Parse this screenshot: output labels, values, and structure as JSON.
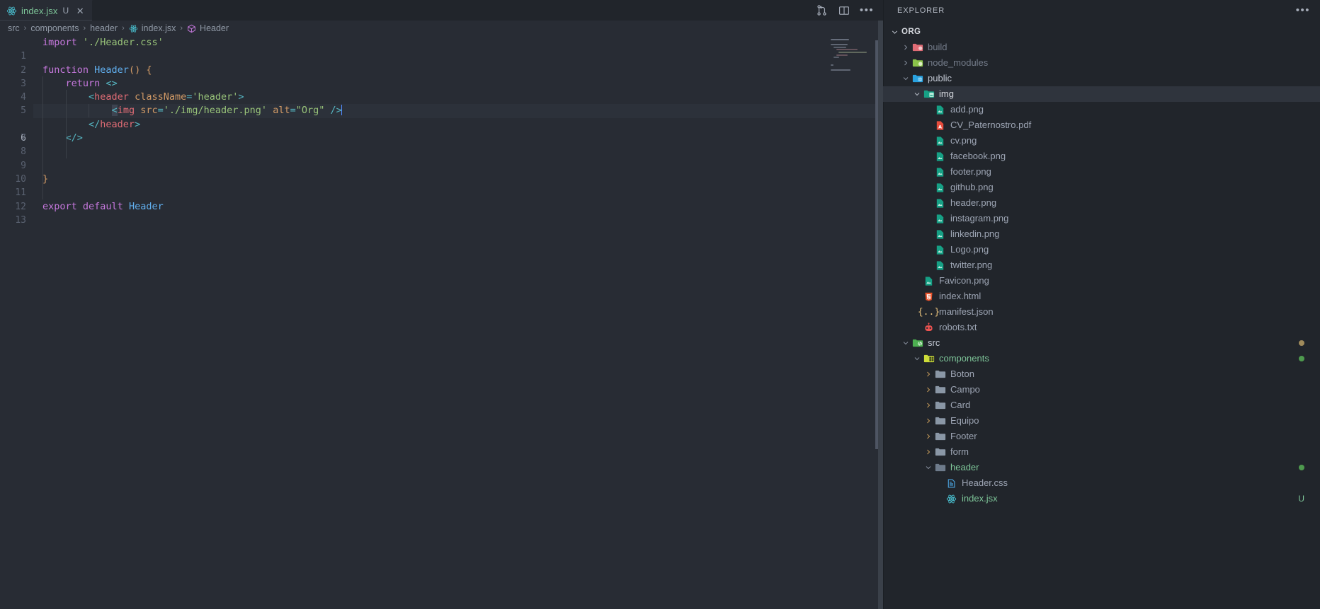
{
  "editor": {
    "tab": {
      "icon": "react-icon",
      "label": "index.jsx",
      "dirty_badge": "U",
      "close_label": "✕"
    },
    "actions": [
      {
        "name": "split-source-control-icon",
        "label": ""
      },
      {
        "name": "split-editor-icon",
        "label": ""
      },
      {
        "name": "more-actions-icon",
        "label": "•••"
      }
    ],
    "breadcrumb": [
      {
        "label": "src",
        "icon": ""
      },
      {
        "label": "components",
        "icon": ""
      },
      {
        "label": "header",
        "icon": ""
      },
      {
        "label": "index.jsx",
        "icon": "react-icon"
      },
      {
        "label": "Header",
        "icon": "cube-icon"
      }
    ],
    "breadcrumb_separator": "›",
    "active_line": 6,
    "cursor_column": 46,
    "lines": [
      {
        "n": "1",
        "text": "import './Header.css'"
      },
      {
        "n": "2",
        "text": ""
      },
      {
        "n": "3",
        "text": "function Header() {"
      },
      {
        "n": "4",
        "text": "    return <>"
      },
      {
        "n": "5",
        "text": "        <header className='header'>"
      },
      {
        "n": "6",
        "text": "            <img src='./img/header.png' alt=\"Org\" />"
      },
      {
        "n": "7",
        "text": "        </header>"
      },
      {
        "n": "8",
        "text": "    </>"
      },
      {
        "n": "9",
        "text": ""
      },
      {
        "n": "10",
        "text": ""
      },
      {
        "n": "11",
        "text": "}"
      },
      {
        "n": "12",
        "text": ""
      },
      {
        "n": "13",
        "text": "export default Header"
      }
    ],
    "colors": {
      "background": "#282c34",
      "active_line": "#2c313a",
      "keyword": "#c678dd",
      "string": "#98c379",
      "function": "#61afef",
      "tag": "#e06c75",
      "attribute": "#d19a66",
      "operator": "#56b6c2",
      "text": "#abb2bf",
      "line_number": "#5a6271",
      "cursor": "#528bff"
    }
  },
  "sidebar": {
    "title": "EXPLORER",
    "more_label": "•••",
    "root": {
      "label": "ORG",
      "expanded": true
    },
    "tree": [
      {
        "label": "build",
        "type": "folder",
        "icon": "folder-build-icon",
        "indent": 1,
        "state": "collapsed",
        "dimmed": true
      },
      {
        "label": "node_modules",
        "type": "folder",
        "icon": "folder-node-icon",
        "indent": 1,
        "state": "collapsed",
        "dimmed": true
      },
      {
        "label": "public",
        "type": "folder",
        "icon": "folder-public-icon",
        "indent": 1,
        "state": "expanded"
      },
      {
        "label": "img",
        "type": "folder",
        "icon": "folder-images-icon",
        "indent": 2,
        "state": "expanded",
        "selected": true
      },
      {
        "label": "add.png",
        "type": "file",
        "icon": "image-file-icon",
        "indent": 4,
        "state": "leaf"
      },
      {
        "label": "CV_Paternostro.pdf",
        "type": "file",
        "icon": "pdf-file-icon",
        "indent": 4,
        "state": "leaf"
      },
      {
        "label": "cv.png",
        "type": "file",
        "icon": "image-file-icon",
        "indent": 4,
        "state": "leaf"
      },
      {
        "label": "facebook.png",
        "type": "file",
        "icon": "image-file-icon",
        "indent": 4,
        "state": "leaf"
      },
      {
        "label": "footer.png",
        "type": "file",
        "icon": "image-file-icon",
        "indent": 4,
        "state": "leaf"
      },
      {
        "label": "github.png",
        "type": "file",
        "icon": "image-file-icon",
        "indent": 4,
        "state": "leaf"
      },
      {
        "label": "header.png",
        "type": "file",
        "icon": "image-file-icon",
        "indent": 4,
        "state": "leaf"
      },
      {
        "label": "instagram.png",
        "type": "file",
        "icon": "image-file-icon",
        "indent": 4,
        "state": "leaf"
      },
      {
        "label": "linkedin.png",
        "type": "file",
        "icon": "image-file-icon",
        "indent": 4,
        "state": "leaf"
      },
      {
        "label": "Logo.png",
        "type": "file",
        "icon": "image-file-icon",
        "indent": 4,
        "state": "leaf"
      },
      {
        "label": "twitter.png",
        "type": "file",
        "icon": "image-file-icon",
        "indent": 4,
        "state": "leaf"
      },
      {
        "label": "Favicon.png",
        "type": "file",
        "icon": "image-file-icon",
        "indent": 3,
        "state": "leaf"
      },
      {
        "label": "index.html",
        "type": "file",
        "icon": "html-file-icon",
        "indent": 3,
        "state": "leaf"
      },
      {
        "label": "manifest.json",
        "type": "file",
        "icon": "json-file-icon",
        "indent": 3,
        "state": "leaf"
      },
      {
        "label": "robots.txt",
        "type": "file",
        "icon": "robots-file-icon",
        "indent": 3,
        "state": "leaf"
      },
      {
        "label": "src",
        "type": "folder",
        "icon": "folder-src-icon",
        "indent": 1,
        "state": "expanded",
        "git_dot": "#a08b5b"
      },
      {
        "label": "components",
        "type": "folder",
        "icon": "folder-components-icon",
        "indent": 2,
        "state": "expanded",
        "git_dot": "#5a9e5a",
        "git_color": "#7ec699"
      },
      {
        "label": "Boton",
        "type": "folder",
        "icon": "folder-plain-icon",
        "indent": 3,
        "state": "collapsed"
      },
      {
        "label": "Campo",
        "type": "folder",
        "icon": "folder-plain-icon",
        "indent": 3,
        "state": "collapsed"
      },
      {
        "label": "Card",
        "type": "folder",
        "icon": "folder-plain-icon",
        "indent": 3,
        "state": "collapsed"
      },
      {
        "label": "Equipo",
        "type": "folder",
        "icon": "folder-plain-icon",
        "indent": 3,
        "state": "collapsed"
      },
      {
        "label": "Footer",
        "type": "folder",
        "icon": "folder-plain-icon",
        "indent": 3,
        "state": "collapsed"
      },
      {
        "label": "form",
        "type": "folder",
        "icon": "folder-plain-icon",
        "indent": 3,
        "state": "collapsed"
      },
      {
        "label": "header",
        "type": "folder",
        "icon": "folder-open-icon",
        "indent": 3,
        "state": "expanded",
        "git_dot": "#5a9e5a",
        "git_color": "#7ec699"
      },
      {
        "label": "Header.css",
        "type": "file",
        "icon": "css-file-icon",
        "indent": 5,
        "state": "leaf"
      },
      {
        "label": "index.jsx",
        "type": "file",
        "icon": "react-file-icon",
        "indent": 5,
        "state": "leaf",
        "git_badge": "U",
        "git_color": "#7ec699"
      }
    ]
  }
}
